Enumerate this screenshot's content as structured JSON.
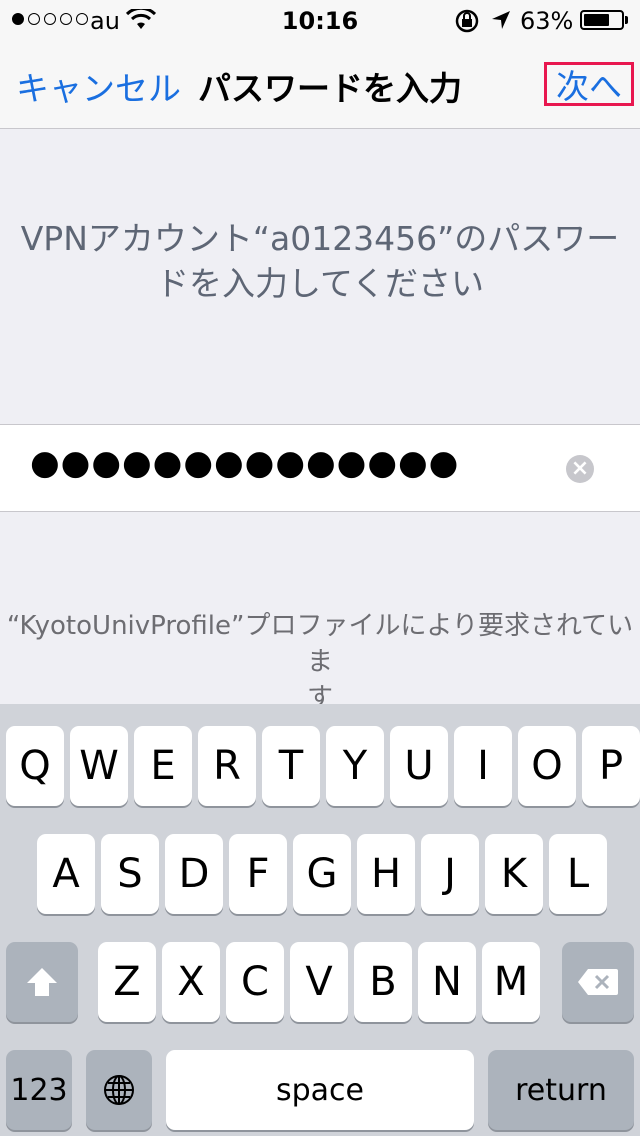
{
  "status_bar": {
    "carrier": "au",
    "time": "10:16",
    "battery": "63%",
    "battery_level": 0.63
  },
  "nav": {
    "cancel": "キャンセル",
    "title": "パスワードを入力",
    "next": "次へ"
  },
  "prompt": {
    "line1": "VPNアカウント“a0123456”のパスワー",
    "line2": "ドを入力してください"
  },
  "password_field": {
    "masked_value": "●●●●●●●●●●●●●●"
  },
  "note": {
    "line1": "“KyotoUnivProfile”プロファイルにより要求されていま",
    "line2": "す"
  },
  "keyboard": {
    "row1": [
      "Q",
      "W",
      "E",
      "R",
      "T",
      "Y",
      "U",
      "I",
      "O",
      "P"
    ],
    "row2": [
      "A",
      "S",
      "D",
      "F",
      "G",
      "H",
      "J",
      "K",
      "L"
    ],
    "row3": [
      "Z",
      "X",
      "C",
      "V",
      "B",
      "N",
      "M"
    ],
    "numbers": "123",
    "space": "space",
    "return": "return"
  }
}
